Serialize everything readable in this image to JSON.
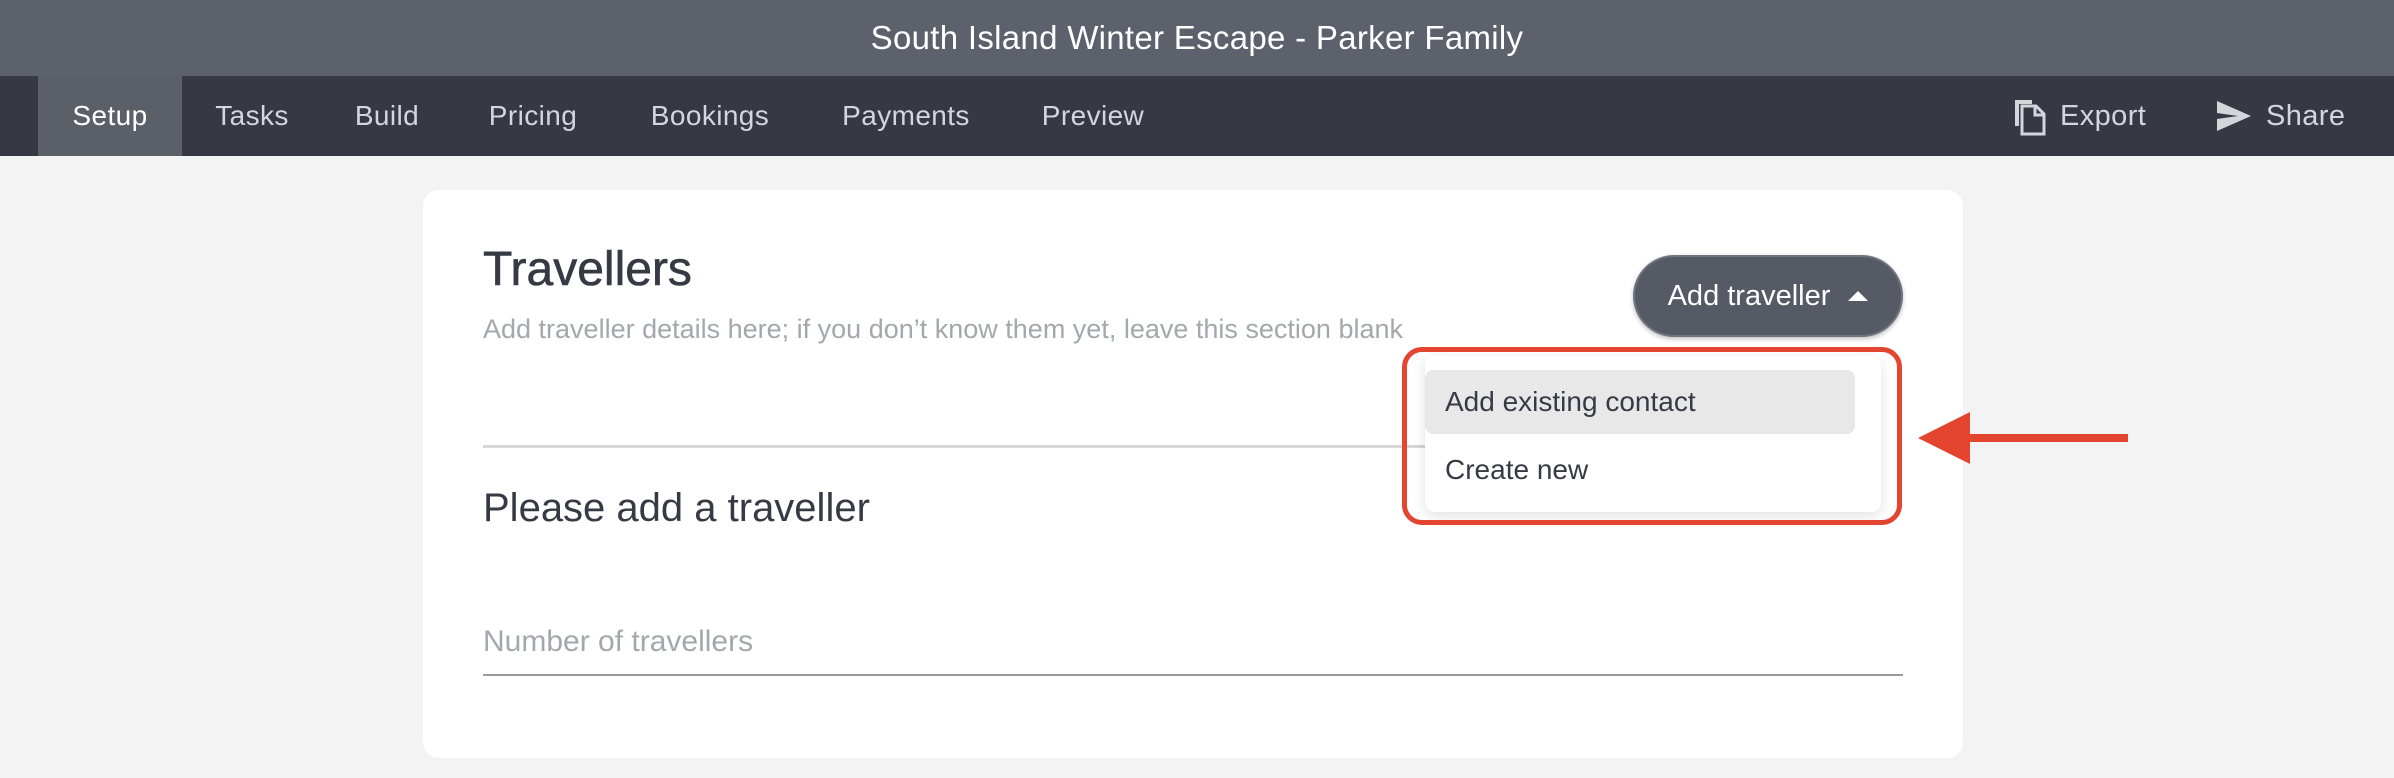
{
  "window": {
    "title": "South Island Winter Escape - Parker Family"
  },
  "nav": {
    "tabs": [
      {
        "label": "Setup",
        "active": true
      },
      {
        "label": "Tasks",
        "active": false
      },
      {
        "label": "Build",
        "active": false
      },
      {
        "label": "Pricing",
        "active": false
      },
      {
        "label": "Bookings",
        "active": false
      },
      {
        "label": "Payments",
        "active": false
      },
      {
        "label": "Preview",
        "active": false
      }
    ],
    "actions": {
      "export": {
        "label": "Export",
        "icon": "copy-icon"
      },
      "share": {
        "label": "Share",
        "icon": "send-icon"
      }
    }
  },
  "travellers": {
    "title": "Travellers",
    "subtitle": "Add traveller details here; if you don’t know them yet, leave this section blank",
    "add_button_label": "Add traveller",
    "empty_state": "Please add a traveller",
    "number_placeholder": "Number of travellers",
    "number_value": "",
    "dropdown": {
      "open": true,
      "items": [
        {
          "label": "Add existing contact",
          "highlighted": true
        },
        {
          "label": "Create new",
          "highlighted": false
        }
      ]
    }
  },
  "annotation": {
    "color": "#e3452e"
  },
  "colors": {
    "titlebar": "#5d616b",
    "navbar": "#363944",
    "active_tab": "#5b5f68",
    "button": "#555a65"
  }
}
